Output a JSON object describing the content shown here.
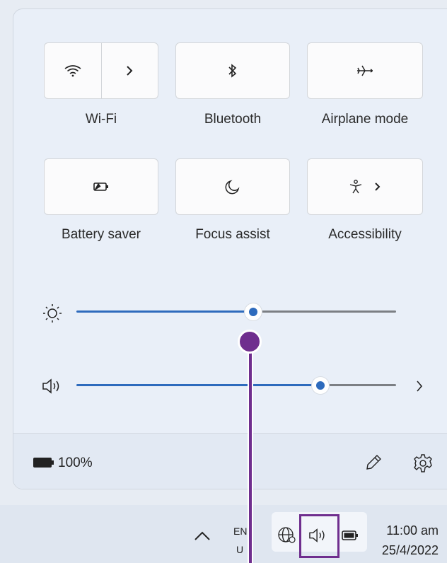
{
  "quick_settings": {
    "tiles": [
      {
        "label": "Wi-Fi",
        "icon": "wifi-icon",
        "secondary_icon": "chevron-right-icon"
      },
      {
        "label": "Bluetooth",
        "icon": "bluetooth-icon"
      },
      {
        "label": "Airplane mode",
        "icon": "airplane-icon"
      },
      {
        "label": "Battery saver",
        "icon": "battery-saver-icon"
      },
      {
        "label": "Focus assist",
        "icon": "moon-icon"
      },
      {
        "label": "Accessibility",
        "icon": "accessibility-icon",
        "secondary_icon": "chevron-right-icon"
      }
    ],
    "brightness": {
      "icon": "brightness-icon",
      "level": 0.54
    },
    "volume": {
      "icon": "speaker-icon",
      "level": 0.75,
      "more_icon": "chevron-right-icon"
    }
  },
  "footer": {
    "battery_icon": "battery-icon",
    "battery_text": "100%",
    "edit_icon": "pencil-icon",
    "settings_icon": "gear-icon"
  },
  "taskbar": {
    "overflow_icon": "chevron-up-icon",
    "language_line1": "EN",
    "language_line2": "U",
    "network_icon": "globe-icon",
    "volume_icon": "speaker-icon",
    "battery_icon": "battery-icon",
    "time": "11:00 am",
    "date": "25/4/2022"
  },
  "colors": {
    "accent": "#2e6bbd",
    "annotation": "#6f2e8e",
    "panel_bg": "#e9eff8"
  }
}
